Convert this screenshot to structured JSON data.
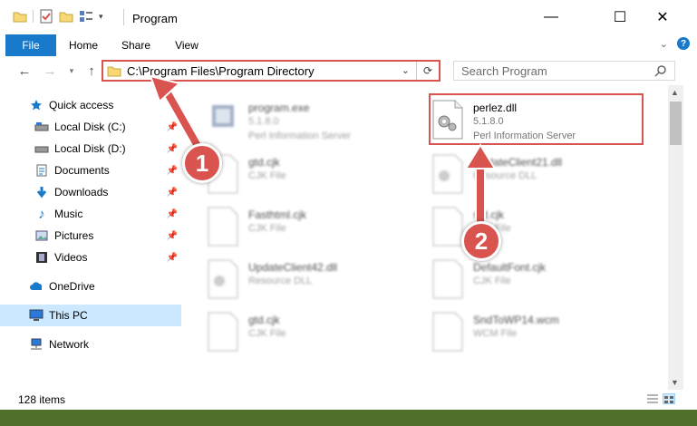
{
  "window": {
    "title": "Program",
    "minimize_label": "—",
    "maximize_label": "☐",
    "close_label": "✕"
  },
  "ribbon": {
    "tabs": [
      "File",
      "Home",
      "Share",
      "View"
    ],
    "help_label": "?"
  },
  "navigation": {
    "address": "C:\\Program Files\\Program Directory",
    "search_placeholder": "Search Program"
  },
  "sidebar": {
    "items": [
      {
        "label": "Quick access",
        "icon": "star-icon"
      },
      {
        "label": "Local Disk (C:)",
        "icon": "drive-icon",
        "pinned": true
      },
      {
        "label": "Local Disk (D:)",
        "icon": "drive-icon",
        "pinned": true
      },
      {
        "label": "Documents",
        "icon": "documents-icon",
        "pinned": true
      },
      {
        "label": "Downloads",
        "icon": "download-icon",
        "pinned": true
      },
      {
        "label": "Music",
        "icon": "music-icon",
        "pinned": true
      },
      {
        "label": "Pictures",
        "icon": "pictures-icon",
        "pinned": true
      },
      {
        "label": "Videos",
        "icon": "videos-icon",
        "pinned": true
      },
      {
        "label": "OneDrive",
        "icon": "cloud-icon"
      },
      {
        "label": "This PC",
        "icon": "computer-icon",
        "selected": true
      },
      {
        "label": "Network",
        "icon": "network-icon"
      }
    ]
  },
  "files": [
    {
      "name": "program.exe",
      "line2": "5.1.8.0",
      "line3": "Perl Information Server"
    },
    {
      "name": "perlez.dll",
      "line2": "5.1.8.0",
      "line3": "Perl Information Server"
    },
    {
      "name": "gtd.cjk",
      "line2": "CJK File"
    },
    {
      "name": "UpdateClient21.dll",
      "line2": "Resource DLL"
    },
    {
      "name": "Fasthtml.cjk",
      "line2": "CJK File"
    },
    {
      "name": "std.cjk",
      "line2": "CJK File"
    },
    {
      "name": "UpdateClient42.dll",
      "line2": "Resource DLL"
    },
    {
      "name": "DefaultFont.cjk",
      "line2": "CJK File"
    },
    {
      "name": "gtd.cjk",
      "line2": "CJK File"
    },
    {
      "name": "SndToWP14.wcm",
      "line2": "WCM File"
    }
  ],
  "status": {
    "item_count": "128 items"
  },
  "annotations": {
    "step1": "1",
    "step2": "2"
  },
  "colors": {
    "accent": "#1979ca",
    "highlight": "#d9534f",
    "selection": "#cce8ff"
  }
}
